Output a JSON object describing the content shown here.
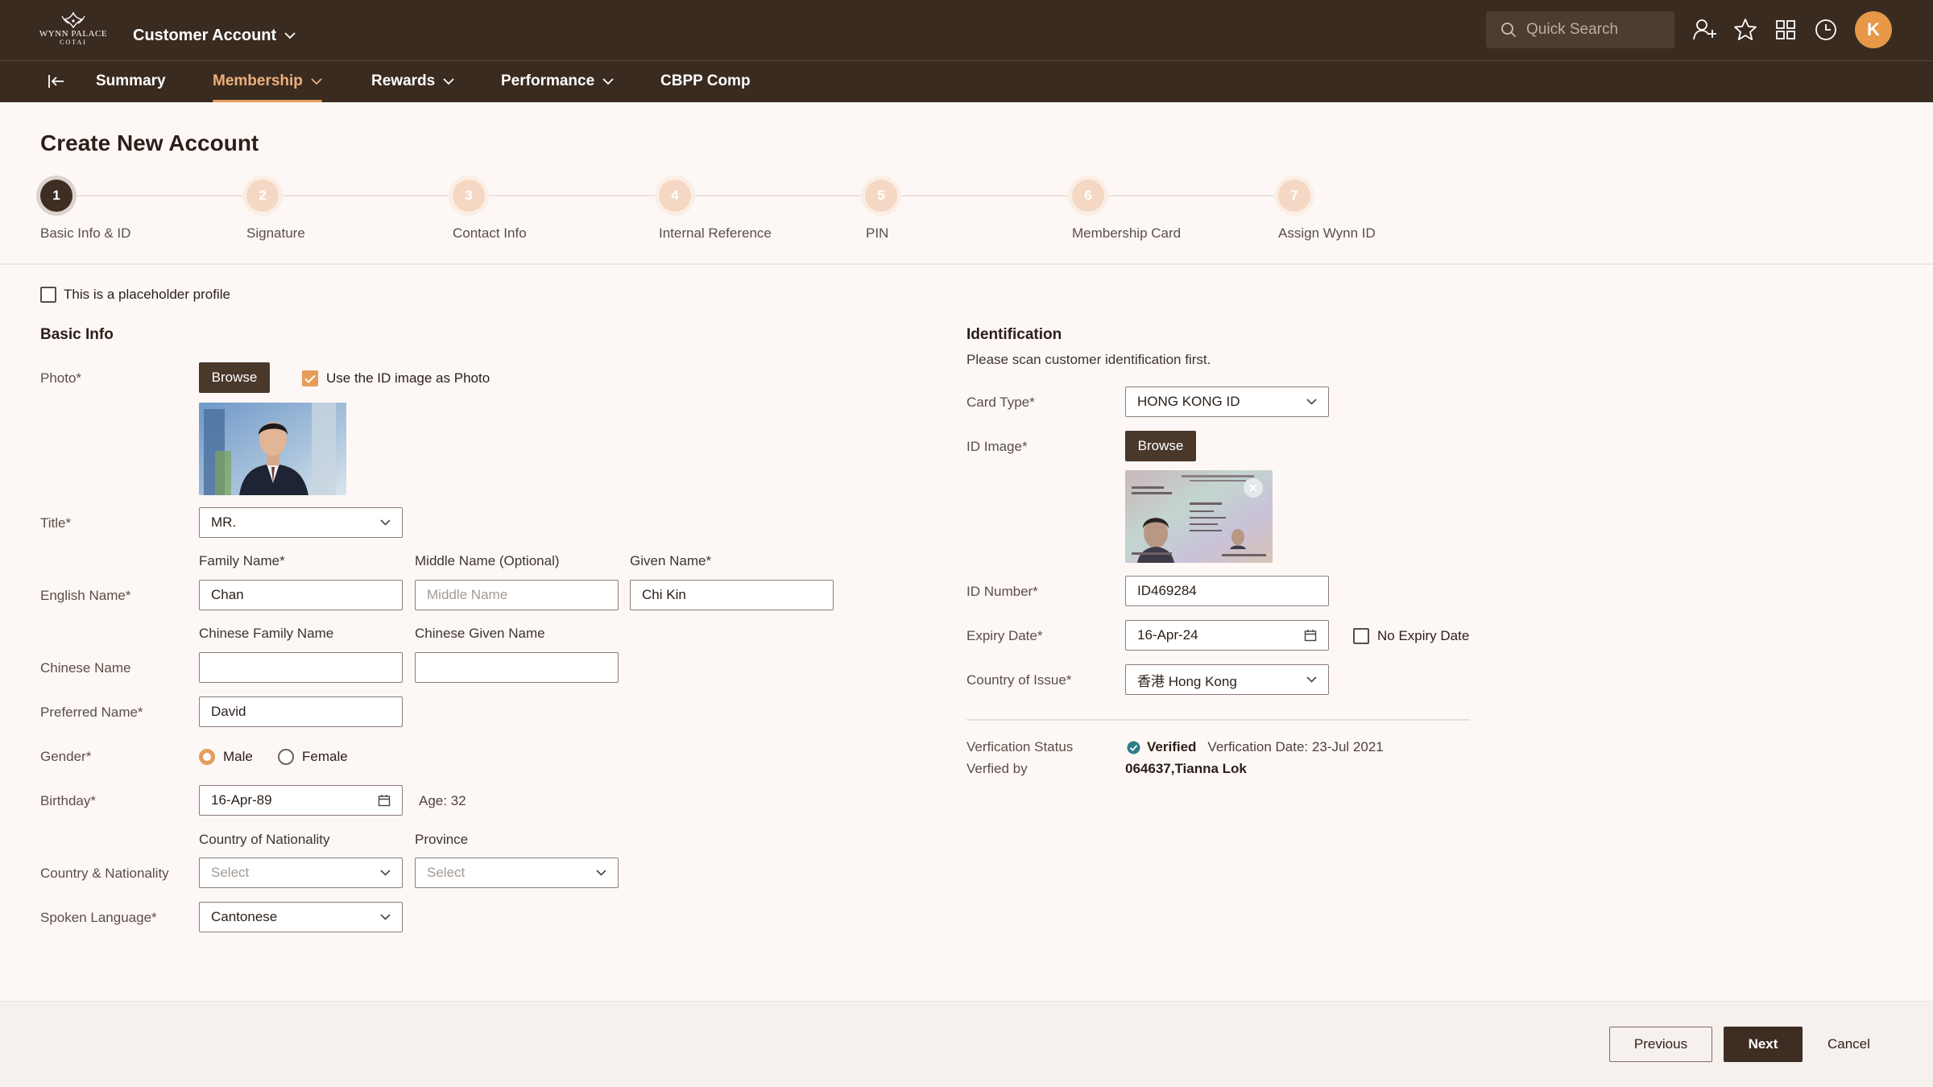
{
  "app": {
    "logo_line1": "WYNN PALACE",
    "logo_line2": "COTAI",
    "account_menu": "Customer Account",
    "search_placeholder": "Quick Search",
    "avatar_initial": "K"
  },
  "nav": {
    "items": [
      {
        "label": "Summary"
      },
      {
        "label": "Membership"
      },
      {
        "label": "Rewards"
      },
      {
        "label": "Performance"
      },
      {
        "label": "CBPP Comp"
      }
    ],
    "active": "Membership"
  },
  "page": {
    "title": "Create New Account"
  },
  "steps": [
    {
      "num": "1",
      "label": "Basic Info & ID"
    },
    {
      "num": "2",
      "label": "Signature"
    },
    {
      "num": "3",
      "label": "Contact Info"
    },
    {
      "num": "4",
      "label": "Internal Reference"
    },
    {
      "num": "5",
      "label": "PIN"
    },
    {
      "num": "6",
      "label": "Membership Card"
    },
    {
      "num": "7",
      "label": "Assign Wynn ID"
    }
  ],
  "placeholder_profile_label": "This is a placeholder profile",
  "basic": {
    "section": "Basic Info",
    "photo_label": "Photo*",
    "browse": "Browse",
    "use_id_photo_label": "Use the ID image as Photo",
    "title_label": "Title*",
    "title_value": "MR.",
    "family_name_label": "Family Name*",
    "middle_name_label": "Middle Name (Optional)",
    "given_name_label": "Given Name*",
    "english_name_label": "English Name*",
    "family_name": "Chan",
    "middle_name_placeholder": "Middle Name",
    "given_name": "Chi Kin",
    "chinese_family_label": "Chinese Family Name",
    "chinese_given_label": "Chinese Given Name",
    "chinese_name_label": "Chinese Name",
    "chinese_family": "",
    "chinese_given": "",
    "preferred_name_label": "Preferred Name*",
    "preferred_name": "David",
    "gender_label": "Gender*",
    "gender_male": "Male",
    "gender_female": "Female",
    "birthday_label": "Birthday*",
    "birthday": "16-Apr-89",
    "age": "Age: 32",
    "nationality_label": "Country of Nationality",
    "province_label": "Province",
    "country_nat_label": "Country & Nationality",
    "nationality_placeholder": "Select",
    "province_placeholder": "Select",
    "spoken_language_label": "Spoken Language*",
    "spoken_language": "Cantonese"
  },
  "identification": {
    "section": "Identification",
    "hint": "Please scan customer identification first.",
    "card_type_label": "Card Type*",
    "card_type": "HONG KONG ID",
    "id_image_label": "ID Image*",
    "browse": "Browse",
    "id_number_label": "ID Number*",
    "id_number": "ID469284",
    "expiry_label": "Expiry Date*",
    "expiry": "16-Apr-24",
    "no_expiry_label": "No Expiry Date",
    "country_issue_label": "Country of Issue*",
    "country_issue": "香港 Hong Kong",
    "verification_status_label": "Verfication Status",
    "verified": "Verified",
    "verification_date": "Verfication Date: 23-Jul 2021",
    "verified_by_label": "Verfied by",
    "verified_by": "064637,Tianna Lok"
  },
  "footer": {
    "previous": "Previous",
    "next": "Next",
    "cancel": "Cancel"
  },
  "colors": {
    "header_bg": "#3a2b20",
    "accent": "#e69d5c",
    "primary_button": "#3d2d22",
    "verified": "#2f7c8a"
  }
}
